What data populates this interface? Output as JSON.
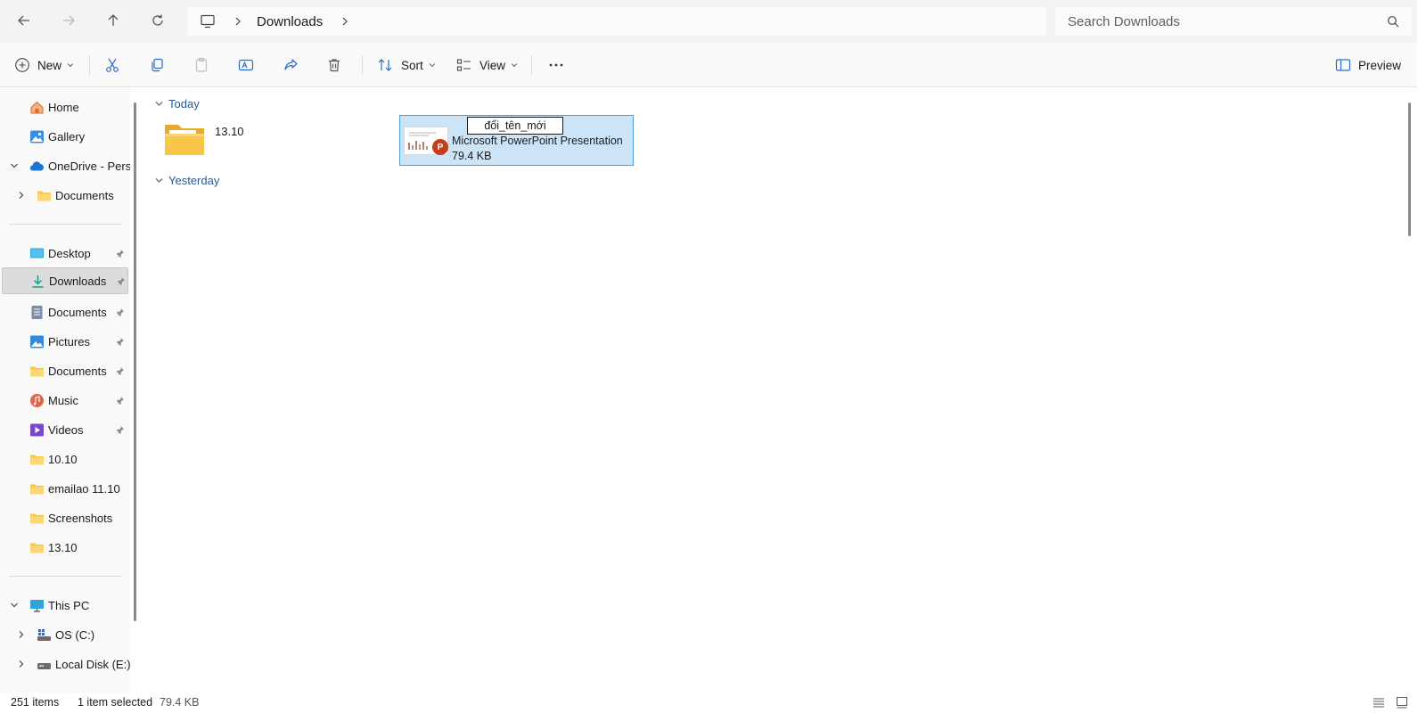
{
  "address": {
    "crumbs": [
      "Downloads"
    ],
    "search_placeholder": "Search Downloads"
  },
  "toolbar": {
    "new_label": "New",
    "sort_label": "Sort",
    "view_label": "View",
    "preview_label": "Preview"
  },
  "sidebar": {
    "items": [
      {
        "label": "Home"
      },
      {
        "label": "Gallery"
      },
      {
        "label": "OneDrive - Perso"
      },
      {
        "label": "Documents"
      },
      {
        "label": "Desktop"
      },
      {
        "label": "Downloads"
      },
      {
        "label": "Documents"
      },
      {
        "label": "Pictures"
      },
      {
        "label": "Documents"
      },
      {
        "label": "Music"
      },
      {
        "label": "Videos"
      },
      {
        "label": "10.10"
      },
      {
        "label": "emailao 11.10"
      },
      {
        "label": "Screenshots"
      },
      {
        "label": "13.10"
      },
      {
        "label": "This PC"
      },
      {
        "label": "OS (C:)"
      },
      {
        "label": "Local Disk (E:)"
      }
    ]
  },
  "content": {
    "groups": [
      {
        "label": "Today"
      },
      {
        "label": "Yesterday"
      }
    ],
    "folder": {
      "name": "13.10"
    },
    "file": {
      "rename_value": "đổi_tên_mới",
      "type": "Microsoft PowerPoint Presentation",
      "size": "79.4 KB"
    }
  },
  "status": {
    "item_count": "251 items",
    "selection": "1 item selected",
    "selection_size": "79.4 KB"
  },
  "colors": {
    "accent": "#2a6dc9",
    "selection_bg": "#cce4f7",
    "folder_yellow": "#f8c74a",
    "group_header": "#2a5a94"
  }
}
